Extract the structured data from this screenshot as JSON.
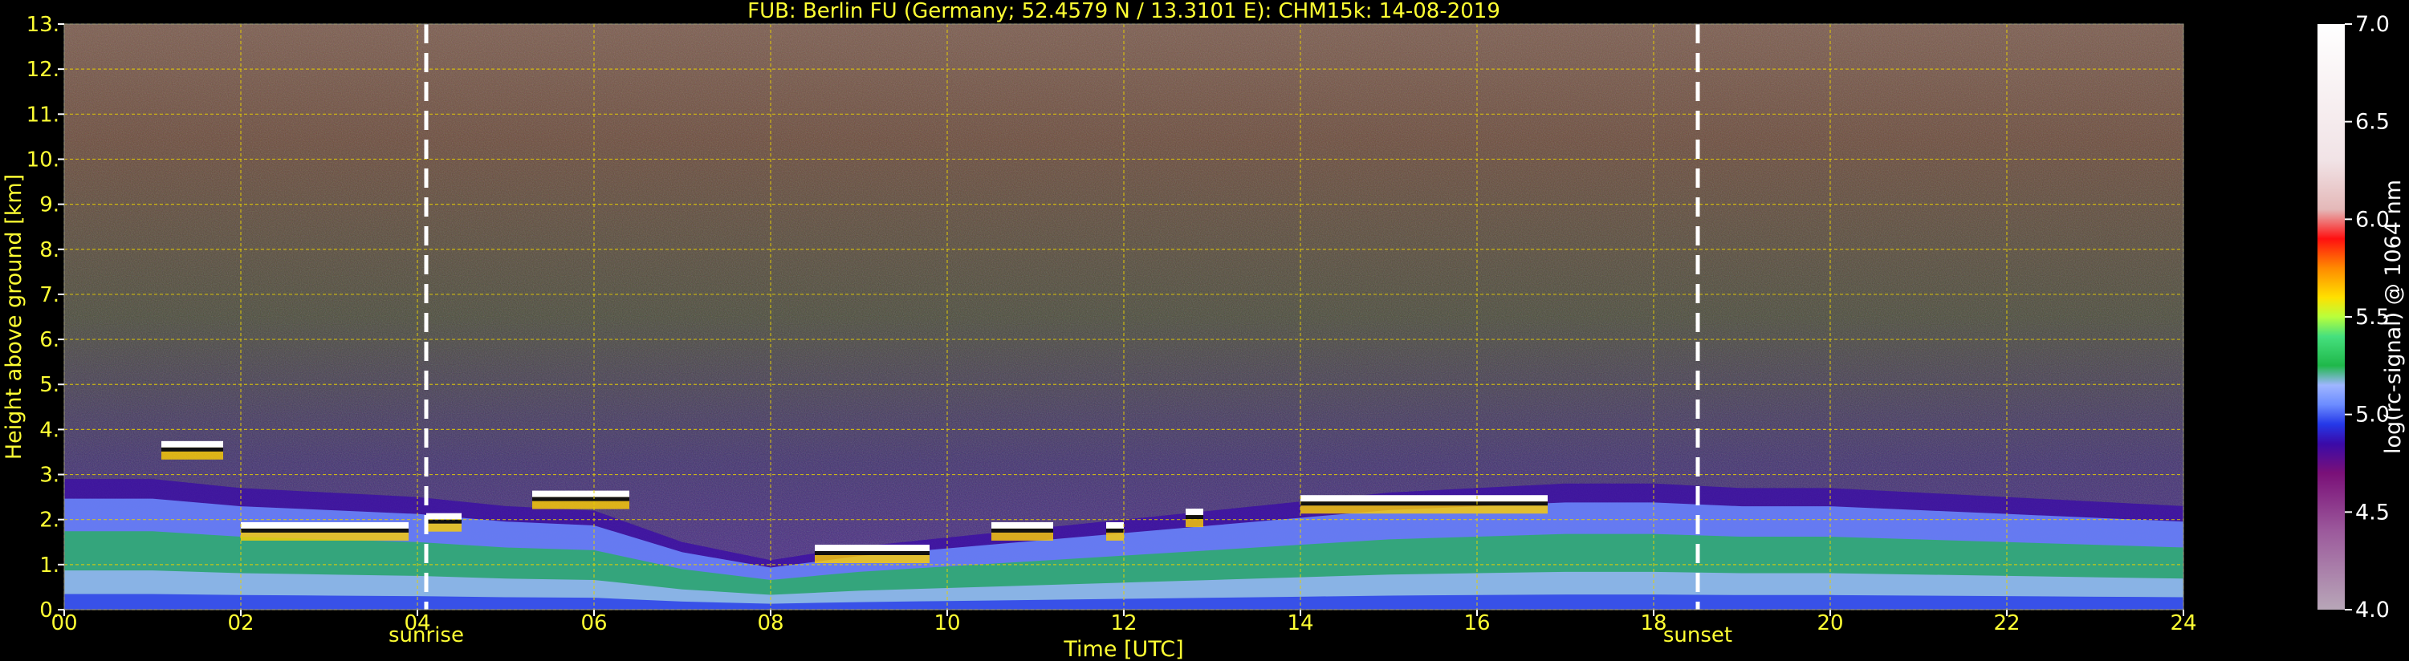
{
  "chart_data": {
    "type": "heatmap",
    "title": "FUB: Berlin FU (Germany; 52.4579 N / 13.3101 E):    CHM15k: 14-08-2019",
    "xlabel": "Time [UTC]",
    "ylabel": "Height above ground [km]",
    "xlim": [
      0,
      24
    ],
    "ylim": [
      0,
      13
    ],
    "xticks": [
      {
        "v": 0,
        "label": "00"
      },
      {
        "v": 2,
        "label": "02"
      },
      {
        "v": 4,
        "label": "04"
      },
      {
        "v": 6,
        "label": "06"
      },
      {
        "v": 8,
        "label": "08"
      },
      {
        "v": 10,
        "label": "10"
      },
      {
        "v": 12,
        "label": "12"
      },
      {
        "v": 14,
        "label": "14"
      },
      {
        "v": 16,
        "label": "16"
      },
      {
        "v": 18,
        "label": "18"
      },
      {
        "v": 20,
        "label": "20"
      },
      {
        "v": 22,
        "label": "22"
      },
      {
        "v": 24,
        "label": "24"
      }
    ],
    "yticks": [
      {
        "v": 0,
        "label": "0."
      },
      {
        "v": 1,
        "label": "1."
      },
      {
        "v": 2,
        "label": "2."
      },
      {
        "v": 3,
        "label": "3."
      },
      {
        "v": 4,
        "label": "4."
      },
      {
        "v": 5,
        "label": "5."
      },
      {
        "v": 6,
        "label": "6."
      },
      {
        "v": 7,
        "label": "7."
      },
      {
        "v": 8,
        "label": "8."
      },
      {
        "v": 9,
        "label": "9."
      },
      {
        "v": 10,
        "label": "10."
      },
      {
        "v": 11,
        "label": "11."
      },
      {
        "v": 12,
        "label": "12."
      },
      {
        "v": 13,
        "label": "13."
      }
    ],
    "grid": true,
    "events": [
      {
        "name": "sunrise",
        "time": 4.1
      },
      {
        "name": "sunset",
        "time": 18.5
      }
    ],
    "colorbar": {
      "label": "log(rc-signal) @ 1064 nm",
      "range": [
        4.0,
        7.0
      ],
      "ticks": [
        {
          "v": 4.0,
          "label": "4.0"
        },
        {
          "v": 4.5,
          "label": "4.5"
        },
        {
          "v": 5.0,
          "label": "5.0"
        },
        {
          "v": 5.5,
          "label": "5.5"
        },
        {
          "v": 6.0,
          "label": "6.0"
        },
        {
          "v": 6.5,
          "label": "6.5"
        },
        {
          "v": 7.0,
          "label": "7.0"
        }
      ],
      "stops": [
        {
          "v": 4.0,
          "color": "#b8a7b8"
        },
        {
          "v": 4.4,
          "color": "#9c5a9c"
        },
        {
          "v": 4.7,
          "color": "#7a1078"
        },
        {
          "v": 4.85,
          "color": "#3a0aa8"
        },
        {
          "v": 4.95,
          "color": "#2438e8"
        },
        {
          "v": 5.05,
          "color": "#6c8cff"
        },
        {
          "v": 5.15,
          "color": "#9fb6ff"
        },
        {
          "v": 5.25,
          "color": "#1fb84a"
        },
        {
          "v": 5.4,
          "color": "#46e07e"
        },
        {
          "v": 5.5,
          "color": "#b8ff3c"
        },
        {
          "v": 5.6,
          "color": "#ffe000"
        },
        {
          "v": 5.75,
          "color": "#ff8a00"
        },
        {
          "v": 5.9,
          "color": "#ff1010"
        },
        {
          "v": 6.05,
          "color": "#e4b8b8"
        },
        {
          "v": 6.3,
          "color": "#f1e3e6"
        },
        {
          "v": 7.0,
          "color": "#ffffff"
        }
      ]
    },
    "layers": {
      "boundary_layer_top_km": [
        [
          0,
          2.9
        ],
        [
          1,
          2.9
        ],
        [
          2,
          2.7
        ],
        [
          3,
          2.6
        ],
        [
          4,
          2.5
        ],
        [
          5,
          2.3
        ],
        [
          6,
          2.2
        ],
        [
          7,
          1.5
        ],
        [
          8,
          1.1
        ],
        [
          9,
          1.4
        ],
        [
          10,
          1.6
        ],
        [
          11,
          1.8
        ],
        [
          12,
          2.0
        ],
        [
          13,
          2.2
        ],
        [
          14,
          2.4
        ],
        [
          15,
          2.6
        ],
        [
          16,
          2.7
        ],
        [
          17,
          2.8
        ],
        [
          18,
          2.8
        ],
        [
          19,
          2.7
        ],
        [
          20,
          2.7
        ],
        [
          21,
          2.6
        ],
        [
          22,
          2.5
        ],
        [
          23,
          2.4
        ],
        [
          24,
          2.3
        ]
      ],
      "cloud_segments": [
        {
          "t0": 1.1,
          "t1": 1.8,
          "h": 3.6
        },
        {
          "t0": 2.0,
          "t1": 3.9,
          "h": 1.8
        },
        {
          "t0": 4.1,
          "t1": 4.5,
          "h": 2.0
        },
        {
          "t0": 5.3,
          "t1": 6.4,
          "h": 2.5
        },
        {
          "t0": 8.5,
          "t1": 9.8,
          "h": 1.3
        },
        {
          "t0": 10.5,
          "t1": 11.2,
          "h": 1.8
        },
        {
          "t0": 11.8,
          "t1": 12.0,
          "h": 1.8
        },
        {
          "t0": 12.7,
          "t1": 12.9,
          "h": 2.1
        },
        {
          "t0": 14.0,
          "t1": 16.8,
          "h": 2.4
        }
      ]
    }
  }
}
